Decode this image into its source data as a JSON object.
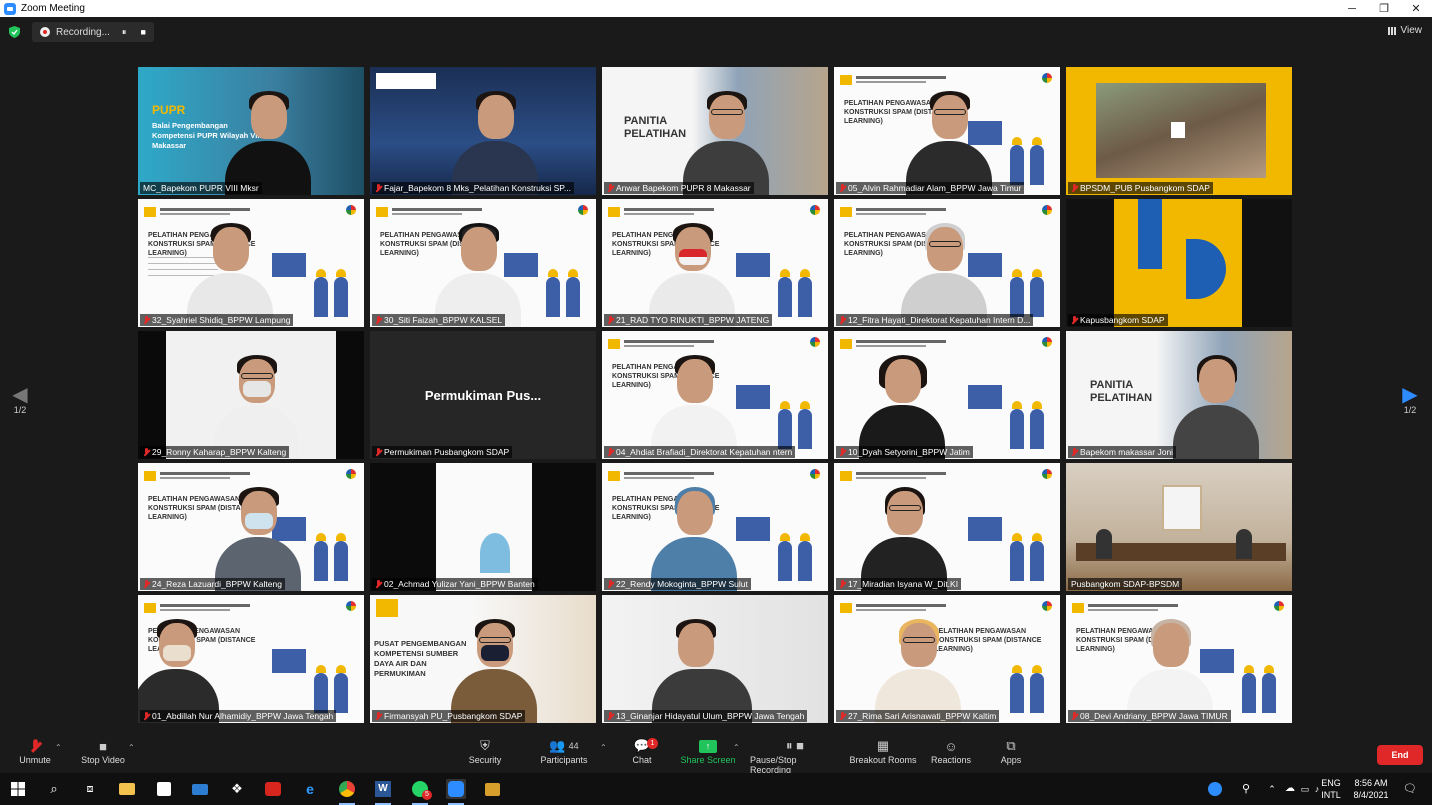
{
  "window": {
    "title": "Zoom Meeting",
    "controls": [
      "─",
      "❐",
      "✕"
    ]
  },
  "top_bar": {
    "recording_label": "Recording...",
    "pause_icon": "⏸",
    "stop_icon": "■",
    "view_label": "View"
  },
  "pagination": {
    "prev_label": "1/2",
    "next_label": "1/2"
  },
  "participants": [
    {
      "name": "MC_Bapekom PUPR VIII Mksr",
      "muted": false,
      "active": true
    },
    {
      "name": "Fajar_Bapekom 8 Mks_Pelatihan Konstruksi SP...",
      "muted": true
    },
    {
      "name": "Anwar Bapekom PUPR 8 Makassar",
      "muted": true
    },
    {
      "name": "05_Alvin Rahmadiar Alam_BPPW Jawa Timur",
      "muted": true
    },
    {
      "name": "BPSDM_PUB Pusbangkom SDAP",
      "muted": true
    },
    {
      "name": "32_Syahriel Shidiq_BPPW Lampung",
      "muted": true
    },
    {
      "name": "30_Siti Faizah_BPPW KALSEL",
      "muted": true
    },
    {
      "name": "21_RAD TYO RINUKTI_BPPW JATENG",
      "muted": true
    },
    {
      "name": "12_Fitra Hayati_Direktorat Kepatuhan Intern D...",
      "muted": true
    },
    {
      "name": "Kapusbangkom SDAP",
      "muted": true
    },
    {
      "name": "29_Ronny Kaharap_BPPW Kalteng",
      "muted": true
    },
    {
      "name": "Permukiman Pusbangkom SDAP",
      "muted": true,
      "display_text": "Permukiman  Pus..."
    },
    {
      "name": "04_Ahdiat Brafiadi_Direktorat Kepatuhan  ntern",
      "muted": true
    },
    {
      "name": "10_Dyah Setyorini_BPPW Jatim",
      "muted": true
    },
    {
      "name": "Bapekom makassar Joni",
      "muted": true
    },
    {
      "name": "24_Reza Lazuardi_BPPW Kalteng",
      "muted": true
    },
    {
      "name": "02_Achmad Yulizar Yani_BPPW Banten",
      "muted": true
    },
    {
      "name": "22_Rendy Mokoginta_BPPW Sulut",
      "muted": true
    },
    {
      "name": "17_Miradian Isyana W_Dit.KI",
      "muted": true
    },
    {
      "name": "Pusbangkom SDAP-BPSDM",
      "muted": false
    },
    {
      "name": "01_Abdillah Nur Alhamidiy_BPPW Jawa Tengah",
      "muted": true
    },
    {
      "name": "Firmansyah PU_Pusbangkom SDAP",
      "muted": true
    },
    {
      "name": "13_Ginanjar Hidayatul Ulum_BPPW Jawa Tengah",
      "muted": true
    },
    {
      "name": "27_Rima Sari Arisnawati_BPPW Kaltim",
      "muted": true
    },
    {
      "name": "08_Devi Andriany_BPPW Jawa TIMUR",
      "muted": true
    }
  ],
  "slide_texts": {
    "pelatihan": "PELATIHAN PENGAWASAN KONSTRUKSI SPAM (DISTANCE LEARNING)",
    "panitia": "PANITIA PELATIHAN",
    "pupr": "PUPR",
    "balai": "Balai Pengembangan Kompetensi PUPR Wilayah VIII Makassar",
    "pusat": "PUSAT PENGEMBANGAN KOMPETENSI SUMBER DAYA AIR DAN PERMUKIMAN"
  },
  "toolbar": {
    "unmute": "Unmute",
    "stop_video": "Stop Video",
    "security": "Security",
    "participants": "Participants",
    "participants_count": "44",
    "chat": "Chat",
    "chat_badge": "1",
    "share_screen": "Share Screen",
    "pause_recording": "Pause/Stop Recording",
    "breakout_rooms": "Breakout Rooms",
    "reactions": "Reactions",
    "apps": "Apps",
    "end": "End"
  },
  "taskbar": {
    "lang_top": "ENG",
    "lang_bottom": "INTL",
    "time": "8:56 AM",
    "date": "8/4/2021",
    "whatsapp_badge": "5"
  },
  "colors": {
    "active_speaker": "#b5e550",
    "end_button": "#e02828",
    "share_green": "#21c35b",
    "zoom_blue": "#2d8cff"
  }
}
